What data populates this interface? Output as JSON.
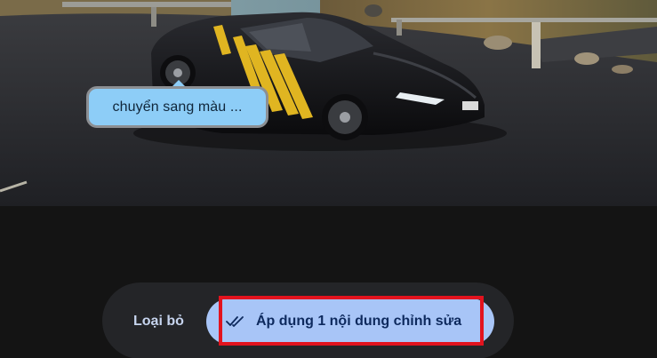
{
  "photo": {
    "subject": "black sports car with yellow stripes on a coastal road"
  },
  "annotation": {
    "text": "chuyển sang màu ..."
  },
  "actions": {
    "discard_label": "Loại bỏ",
    "apply_label": "Áp dụng 1 nội dung chỉnh sửa",
    "apply_icon": "double-check-icon"
  },
  "colors": {
    "accent": "#a8c5f7",
    "bubble": "#8dcdf7",
    "highlight": "#e2131e",
    "background": "#141414"
  }
}
